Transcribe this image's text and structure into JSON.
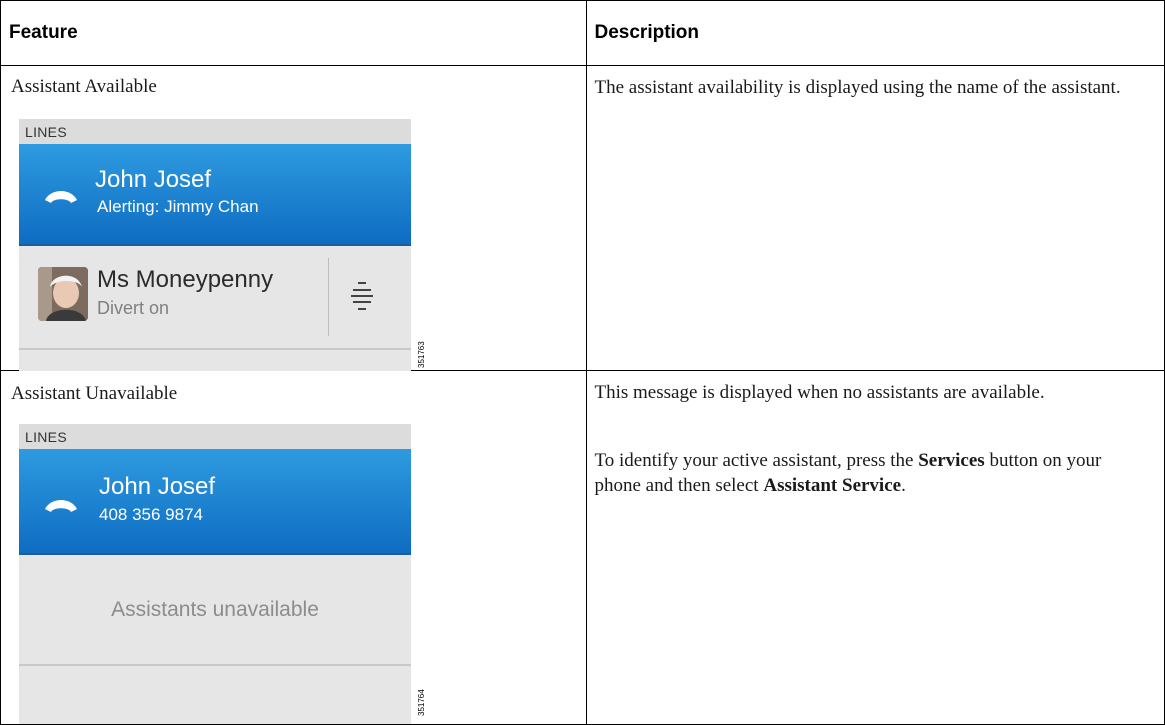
{
  "table": {
    "headers": {
      "feature": "Feature",
      "description": "Description"
    },
    "rows": [
      {
        "feature": "Assistant Available",
        "description": "The assistant availability is displayed using the name of the assistant.",
        "phone": {
          "lines_label": "LINES",
          "line_name": "John Josef",
          "line_sub": "Alerting: Jimmy Chan",
          "assistant_name": "Ms Moneypenny",
          "assistant_status": "Divert on",
          "figure_id": "351763"
        }
      },
      {
        "feature": "Assistant Unavailable",
        "description_p1": "This message is displayed when no assistants are available.",
        "description_p2": {
          "t1": "To identify your active assistant, press the ",
          "b1": "Services",
          "t2": " button on your phone and then select ",
          "b2": "Assistant Service",
          "t3": "."
        },
        "phone": {
          "lines_label": "LINES",
          "line_name": "John Josef",
          "line_sub": "408 356 9874",
          "message": "Assistants unavailable",
          "figure_id": "351764"
        }
      }
    ]
  },
  "colors": {
    "line_blue_top": "#2e9be0",
    "line_blue_bottom": "#0e6cc2",
    "panel_gray": "#e6e6e6"
  },
  "icons": [
    "handset-icon",
    "avatar",
    "menu-icon"
  ]
}
